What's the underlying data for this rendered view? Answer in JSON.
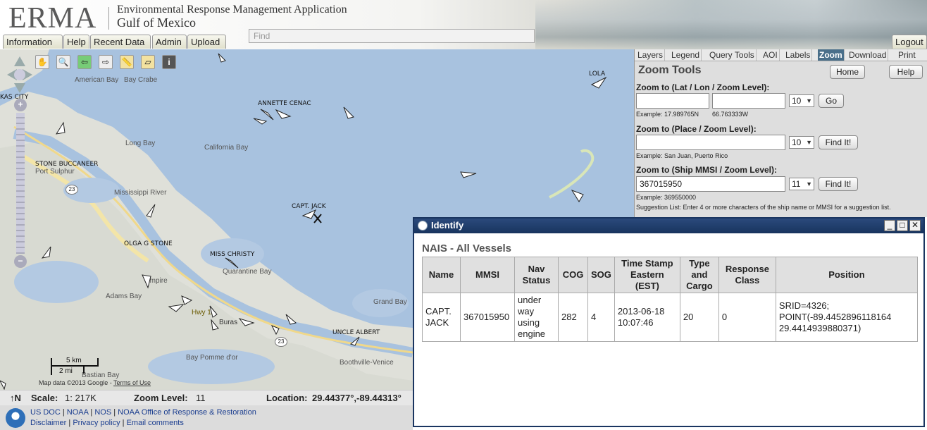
{
  "header": {
    "logo": "ERMA",
    "title": "Environmental Response Management Application",
    "subtitle": "Gulf of Mexico",
    "find_placeholder": "Find",
    "nav": [
      "Information",
      "Help",
      "Recent Data",
      "Admin",
      "Upload"
    ],
    "logout": "Logout"
  },
  "panel": {
    "tabs": [
      "Layers",
      "Legend",
      "Query Tools",
      "AOI",
      "Labels",
      "Zoom",
      "Download",
      "Print"
    ],
    "active_tab": "Zoom",
    "title": "Zoom Tools",
    "home_label": "Home",
    "help_label": "Help",
    "latlon": {
      "label": "Zoom to (Lat / Lon / Zoom Level):",
      "lat_value": "",
      "lon_value": "",
      "zoom": "10",
      "button": "Go",
      "example_lat": "Example: 17.989765N",
      "example_lon": "66.763333W"
    },
    "place": {
      "label": "Zoom to (Place / Zoom Level):",
      "value": "",
      "zoom": "10",
      "button": "Find It!",
      "example": "Example: San Juan, Puerto Rico"
    },
    "ship": {
      "label": "Zoom to (Ship MMSI / Zoom Level):",
      "value": "367015950",
      "zoom": "11",
      "button": "Find It!",
      "example": "Example: 369550000",
      "suggestion": "Suggestion List: Enter 4 or more characters of the ship name or MMSI for a suggestion list."
    }
  },
  "map": {
    "place_labels": [
      "American Bay",
      "Bay Crabe",
      "Long Bay",
      "California Bay",
      "Mississippi River",
      "Port Sulphur",
      "Quarantine Bay",
      "Adams Bay",
      "Empire",
      "Grand Bay",
      "Bay Pomme d'or",
      "Bastian Bay",
      "Boothville-Venice",
      "Buras",
      "Hwy 11"
    ],
    "vessel_labels": [
      "LOLA",
      "ANNETTE CENAC",
      "STONE BUCCANEER",
      "CAPT. JACK",
      "OLGA G STONE",
      "MISS CHRISTY",
      "UNCLE ALBERT",
      "KAS CITY"
    ],
    "road_shields": [
      "23",
      "23"
    ],
    "scale_km": "5 km",
    "scale_mi": "2 mi",
    "attribution": "Map data ©2013 Google -",
    "terms": "Terms of Use"
  },
  "status": {
    "north": "↑N",
    "scale_label": "Scale:",
    "scale_value": "1: 217K",
    "zoom_label": "Zoom Level:",
    "zoom_value": "11",
    "location_label": "Location:",
    "location_value": "29.44377°,-89.44313°"
  },
  "footer": {
    "line1": [
      "US DOC",
      "NOAA",
      "NOS",
      "NOAA Office of Response & Restoration"
    ],
    "line2": [
      "Disclaimer",
      "Privacy policy",
      "Email comments"
    ]
  },
  "identify": {
    "title": "Identify",
    "heading": "NAIS - All Vessels",
    "columns": [
      "Name",
      "MMSI",
      "Nav Status",
      "COG",
      "SOG",
      "Time Stamp Eastern (EST)",
      "Type and Cargo",
      "Response Class",
      "Position"
    ],
    "row": {
      "name": "CAPT. JACK",
      "mmsi": "367015950",
      "nav_status": "under way using engine",
      "cog": "282",
      "sog": "4",
      "timestamp": "2013-06-18 10:07:46",
      "type_cargo": "20",
      "response_class": "0",
      "position": "SRID=4326; POINT(-89.4452896118164 29.4414939880371)"
    }
  },
  "colors": {
    "water": "#a8c2df",
    "land": "#dfe0d9",
    "titlebar": "#1f3d6b",
    "active_tab": "#4a6f8a"
  }
}
